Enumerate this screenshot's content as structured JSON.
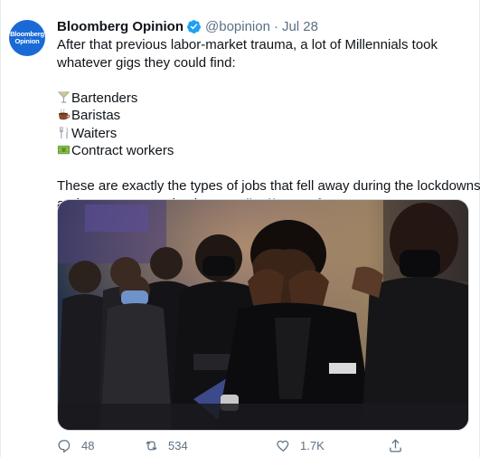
{
  "tweet": {
    "avatar_text_1": "Bloomberg",
    "avatar_text_2": "Opinion",
    "display_name": "Bloomberg Opinion",
    "handle": "@bopinion",
    "separator": "·",
    "date": "Jul 28",
    "lines": {
      "l1": "After that previous labor-market trauma, a lot of Millennials took",
      "l2": "whatever gigs they could find:",
      "l3": "Bartenders",
      "l4": "Baristas",
      "l5": "Waiters",
      "l6": "Contract workers",
      "l7": "These are exactly the types of jobs that fell away during the lockdowns",
      "l8": "and may not come back soon"
    },
    "link": "trib.al/QaFKxfu",
    "icons": {
      "verified": "verified-badge-icon",
      "l3": "cocktail-glass-icon",
      "l4": "hot-beverage-icon",
      "l5": "fork-and-knife-icon",
      "l6": "money-bills-icon"
    },
    "photo_description": "",
    "actions": {
      "replies": "48",
      "retweets": "534",
      "likes": "1.7K"
    },
    "colors": {
      "link": "#1b95e0",
      "verified": "#1da1f2",
      "muted": "#5b7083",
      "avatar_bg": "#1a6ad6"
    }
  }
}
